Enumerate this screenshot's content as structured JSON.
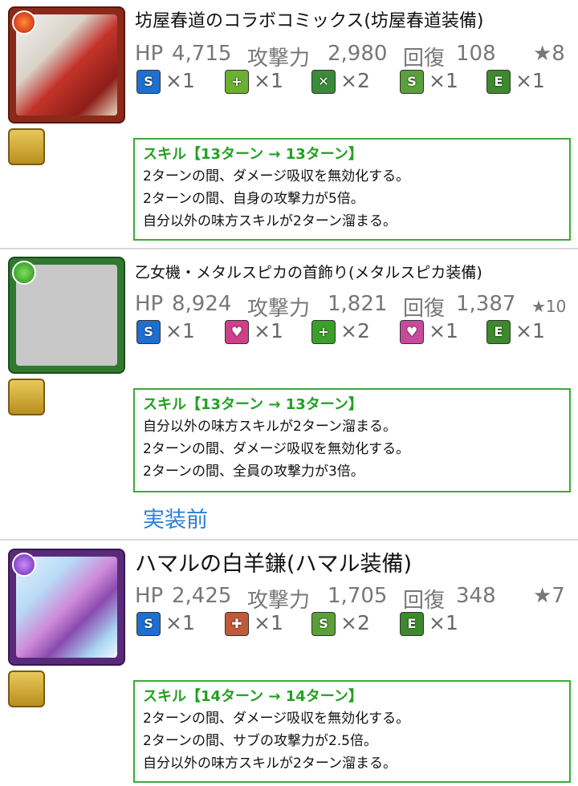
{
  "items": [
    {
      "name": "坊屋春道のコラボコミックス(坊屋春道装備)",
      "hp_label": "HP",
      "hp": "4,715",
      "atk_label": "攻撃力",
      "atk": "2,980",
      "rcv_label": "回復",
      "rcv": "108",
      "rarity": "★8",
      "thumb_icon": "fire-attribute-icon",
      "type_icon": "balance-type-icon",
      "awakenings": [
        {
          "icon": "skill-boost-icon",
          "count": "×1"
        },
        {
          "icon": "enhanced-heal-icon",
          "count": "×1"
        },
        {
          "icon": "two-pronged-attack-icon",
          "count": "×2"
        },
        {
          "icon": "skill-boost-plus-icon",
          "count": "×1"
        },
        {
          "icon": "equip-icon",
          "count": "×1"
        }
      ],
      "skill": {
        "title": "スキル【13ターン → 13ターン】",
        "lines": [
          "2ターンの間、ダメージ吸収を無効化する。",
          "2ターンの間、自身の攻撃力が5倍。",
          "自分以外の味方スキルが2ターン溜まる。"
        ]
      }
    },
    {
      "name": "乙女機・メタルスピカの首飾り(メタルスピカ装備)",
      "hp_label": "HP",
      "hp": "8,924",
      "atk_label": "攻撃力",
      "atk": "1,821",
      "rcv_label": "回復",
      "rcv": "1,387",
      "rarity": "★10",
      "thumb_icon": "wood-attribute-icon",
      "type_icon": "machine-type-icon",
      "awakenings": [
        {
          "icon": "skill-boost-icon",
          "count": "×1"
        },
        {
          "icon": "heart-orb-icon",
          "count": "×1"
        },
        {
          "icon": "wood-row-icon",
          "count": "×2"
        },
        {
          "icon": "heart-key-icon",
          "count": "×1"
        },
        {
          "icon": "equip-icon",
          "count": "×1"
        }
      ],
      "skill": {
        "title": "スキル【13ターン → 13ターン】",
        "lines": [
          "自分以外の味方スキルが2ターン溜まる。",
          "2ターンの間、ダメージ吸収を無効化する。",
          "2ターンの間、全員の攻撃力が3倍。"
        ]
      },
      "status": "実装前"
    },
    {
      "name": "ハマルの白羊鎌(ハマル装備)",
      "hp_label": "HP",
      "hp": "2,425",
      "atk_label": "攻撃力",
      "atk": "1,705",
      "rcv_label": "回復",
      "rcv": "348",
      "rarity": "★7",
      "thumb_icon": "dark-attribute-icon",
      "type_icon": "machine-type-icon",
      "awakenings": [
        {
          "icon": "skill-boost-icon",
          "count": "×1"
        },
        {
          "icon": "auto-heal-icon",
          "count": "×1"
        },
        {
          "icon": "skill-boost-plus-icon",
          "count": "×2"
        },
        {
          "icon": "equip-icon",
          "count": "×1"
        }
      ],
      "skill": {
        "title": "スキル【14ターン → 14ターン】",
        "lines": [
          "2ターンの間、ダメージ吸収を無効化する。",
          "2ターンの間、サブの攻撃力が2.5倍。",
          "自分以外の味方スキルが2ターン溜まる。"
        ]
      }
    }
  ],
  "colors": {
    "skill_green": "#22a022",
    "status_blue": "#2b7fd6",
    "stat_gray": "#777777"
  }
}
